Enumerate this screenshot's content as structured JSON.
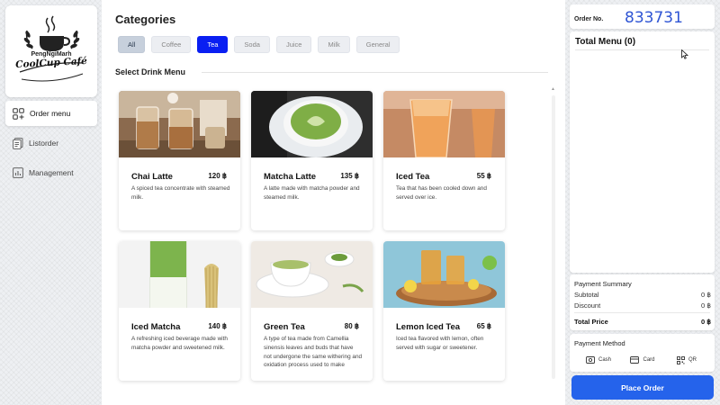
{
  "brand": {
    "top_text": "PengNgiMarh",
    "name": "CoolCup Café"
  },
  "sidebar": {
    "items": [
      {
        "label": "Order menu",
        "icon": "order-menu-icon",
        "active": true
      },
      {
        "label": "Listorder",
        "icon": "list-icon",
        "active": false
      },
      {
        "label": "Management",
        "icon": "chart-icon",
        "active": false
      }
    ]
  },
  "main": {
    "categories_title": "Categories",
    "categories": [
      "All",
      "Coffee",
      "Tea",
      "Soda",
      "Juice",
      "Milk",
      "General"
    ],
    "active_category": "Tea",
    "select_title": "Select Drink Menu",
    "drinks": [
      {
        "name": "Chai Latte",
        "price": "120 ฿",
        "desc": "A spiced tea concentrate with steamed milk."
      },
      {
        "name": "Matcha Latte",
        "price": "135 ฿",
        "desc": "A latte made with matcha powder and steamed milk."
      },
      {
        "name": "Iced Tea",
        "price": "55 ฿",
        "desc": "Tea that has been cooled down and served over ice."
      },
      {
        "name": "Iced Matcha",
        "price": "140 ฿",
        "desc": "A refreshing iced beverage made with matcha powder and sweetened milk."
      },
      {
        "name": "Green Tea",
        "price": "80 ฿",
        "desc": "A type of tea made from Camellia sinensis leaves and buds that have not undergone the same withering and oxidation process used to make"
      },
      {
        "name": "Lemon Iced Tea",
        "price": "65 ฿",
        "desc": "Iced tea flavored with lemon, often served with sugar or sweetener."
      }
    ]
  },
  "order": {
    "label": "Order No.",
    "number": "833731",
    "menu_title": "Total Menu (0)"
  },
  "payment_summary": {
    "title": "Payment Summary",
    "subtotal_label": "Subtotal",
    "subtotal_value": "0 ฿",
    "discount_label": "Discount",
    "discount_value": "0 ฿",
    "total_label": "Total Price",
    "total_value": "0 ฿"
  },
  "payment_method": {
    "title": "Payment Method",
    "options": [
      {
        "label": "Cash",
        "icon": "cash-icon"
      },
      {
        "label": "Card",
        "icon": "card-icon"
      },
      {
        "label": "QR",
        "icon": "qr-icon"
      }
    ]
  },
  "place_order_label": "Place Order",
  "colors": {
    "accent": "#2563eb",
    "active_chip": "#0a1ff2",
    "order_number": "#2f55d4"
  }
}
